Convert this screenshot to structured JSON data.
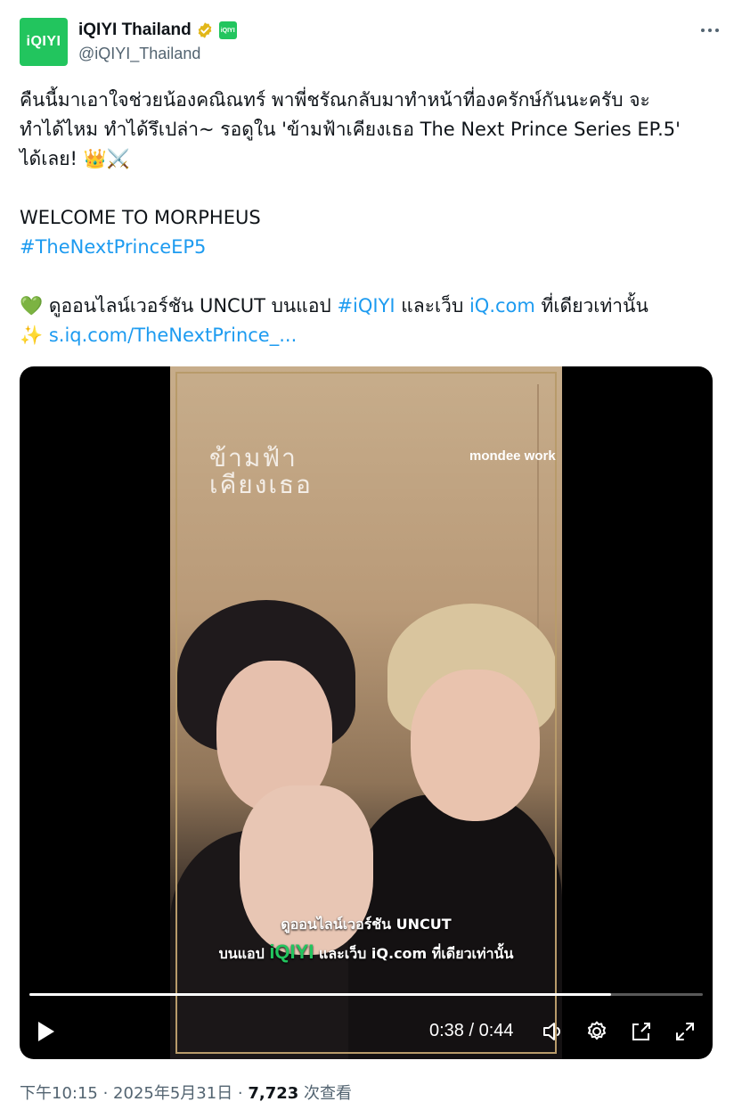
{
  "account": {
    "avatar_text": "iQIYI",
    "display_name": "iQIYI Thailand",
    "affiliate_badge_text": "iQIYI",
    "handle": "@iQIYI_Thailand"
  },
  "tweet": {
    "line1": "คืนนี้มาเอาใจช่วยน้องคณิณทร์ พาพี่ชรัณกลับมาทำหน้าที่องครักษ์กันนะครับ จะ",
    "line2": "ทำได้ไหม ทำได้รึเปล่า~ รอดูใน 'ข้ามฟ้าเคียงเธอ The Next Prince Series EP.5'",
    "line3": "ได้เลย! 👑⚔️",
    "line4": "WELCOME TO MORPHEUS",
    "hashtag": "#TheNextPrinceEP5",
    "line6_emoji": "💚",
    "line6_text1": " ดูออนไลน์เวอร์ชัน UNCUT บนแอป ",
    "line6_hashtag": "#iQIYI",
    "line6_text2": " และเว็บ ",
    "line6_link": "iQ.com",
    "line6_text3": " ที่เดียวเท่านั้น",
    "line7_emoji": "✨ ",
    "line7_link": "s.iq.com/TheNextPrince_..."
  },
  "video": {
    "overlay_title": "ข้ามฟ้า\nเคียงเธอ",
    "overlay_brand": "mondee work",
    "caption_line1": "ดูออนไลน์เวอร์ชัน UNCUT",
    "caption_line2_a": "บนแอป ",
    "caption_line2_brand": "iQIYI",
    "caption_line2_b": " และเว็บ iQ.com ที่เดียวเท่านั้น",
    "time_display": "0:38 / 0:44",
    "progress_fraction": 0.864
  },
  "meta": {
    "time": "下午10:15 · 2025年5月31日 · ",
    "views": "7,723",
    "views_label": " 次查看"
  },
  "colors": {
    "link": "#1d9bf0",
    "brand_green": "#22c55e",
    "secondary_text": "#536471"
  }
}
